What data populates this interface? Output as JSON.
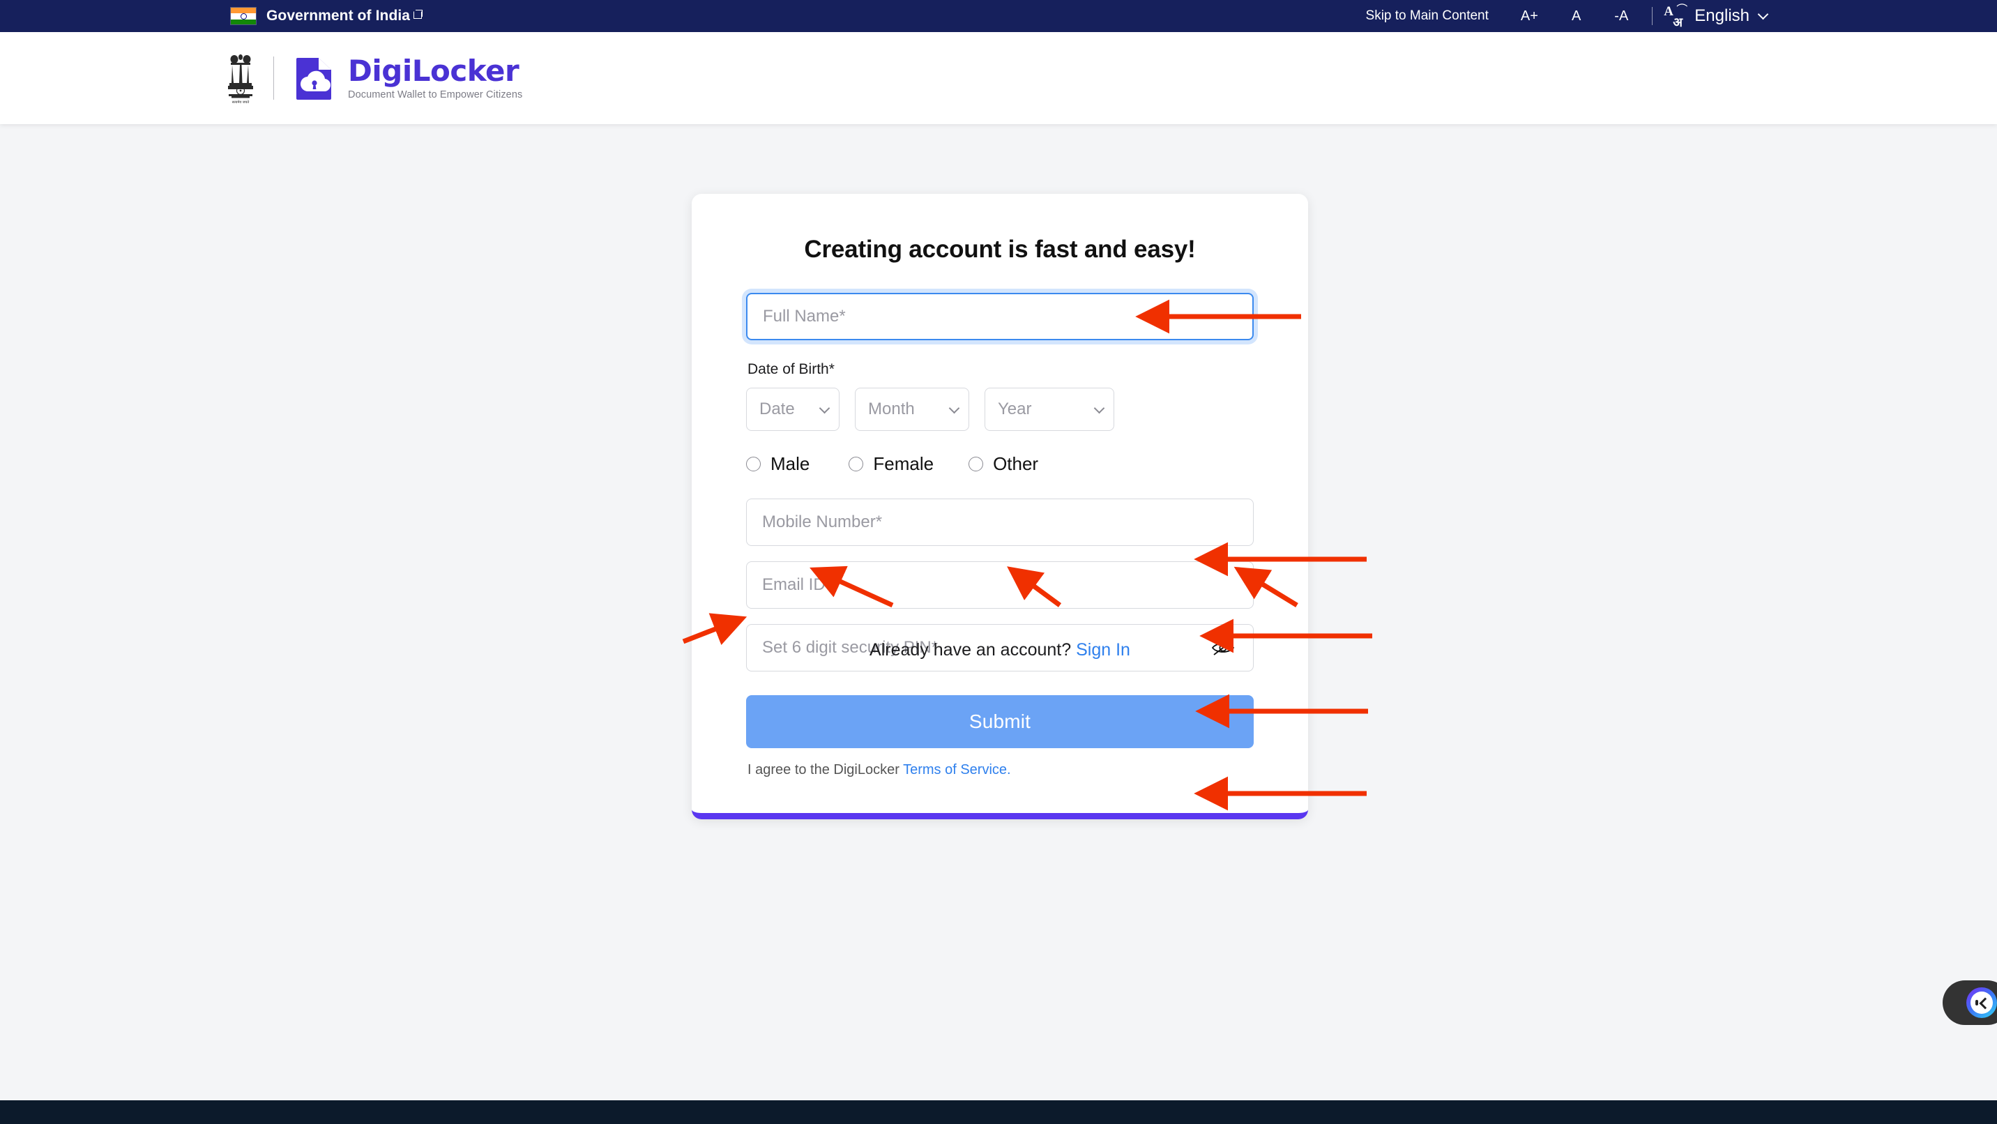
{
  "gov_bar": {
    "flag_icon": "india-flag-icon",
    "title": "Government of India",
    "external_link_icon": "external-link-icon",
    "skip_link": "Skip to Main Content",
    "font_increase": "A+",
    "font_normal": "A",
    "font_decrease": "-A",
    "translate_icon": "translate-icon",
    "translate_latin": "A",
    "translate_devanagari": "अ",
    "language": "English",
    "chevron_icon": "chevron-down-icon",
    "bg_color": "#16205c"
  },
  "header": {
    "emblem_icon": "india-national-emblem-icon",
    "logo_icon": "digilocker-document-cloud-lock-icon",
    "brand_name": "DigiLocker",
    "tagline": "Document Wallet to Empower Citizens",
    "brand_color": "#4a32d4"
  },
  "form": {
    "title": "Creating account is fast and easy!",
    "full_name": {
      "placeholder": "Full Name*",
      "value": "",
      "focused": true
    },
    "dob_label": "Date of Birth*",
    "dob": {
      "date": {
        "selected": "Date"
      },
      "month": {
        "selected": "Month"
      },
      "year": {
        "selected": "Year"
      }
    },
    "gender": {
      "options": [
        {
          "label": "Male",
          "selected": false
        },
        {
          "label": "Female",
          "selected": false
        },
        {
          "label": "Other",
          "selected": false
        }
      ]
    },
    "mobile": {
      "placeholder": "Mobile Number*",
      "value": ""
    },
    "email": {
      "placeholder": "Email ID",
      "value": ""
    },
    "pin": {
      "placeholder": "Set 6 digit security PIN*",
      "value": "",
      "toggle_icon": "eye-off-icon"
    },
    "submit_label": "Submit",
    "submit_color": "#6ba3f5",
    "terms_prefix": "I agree to the DigiLocker ",
    "terms_link": "Terms of Service.",
    "accent_color": "#5a37f0"
  },
  "signin": {
    "prompt": "Already have an account? ",
    "link": "Sign In"
  },
  "chat": {
    "icon": "chat-assistant-icon"
  },
  "annotations": {
    "color": "#f03000",
    "arrows": [
      {
        "target": "full-name-input"
      },
      {
        "target": "dob-date-select"
      },
      {
        "target": "dob-month-select"
      },
      {
        "target": "dob-year-select"
      },
      {
        "target": "gender-male-radio"
      },
      {
        "target": "mobile-input"
      },
      {
        "target": "email-input"
      },
      {
        "target": "pin-input"
      },
      {
        "target": "submit-button"
      }
    ]
  }
}
